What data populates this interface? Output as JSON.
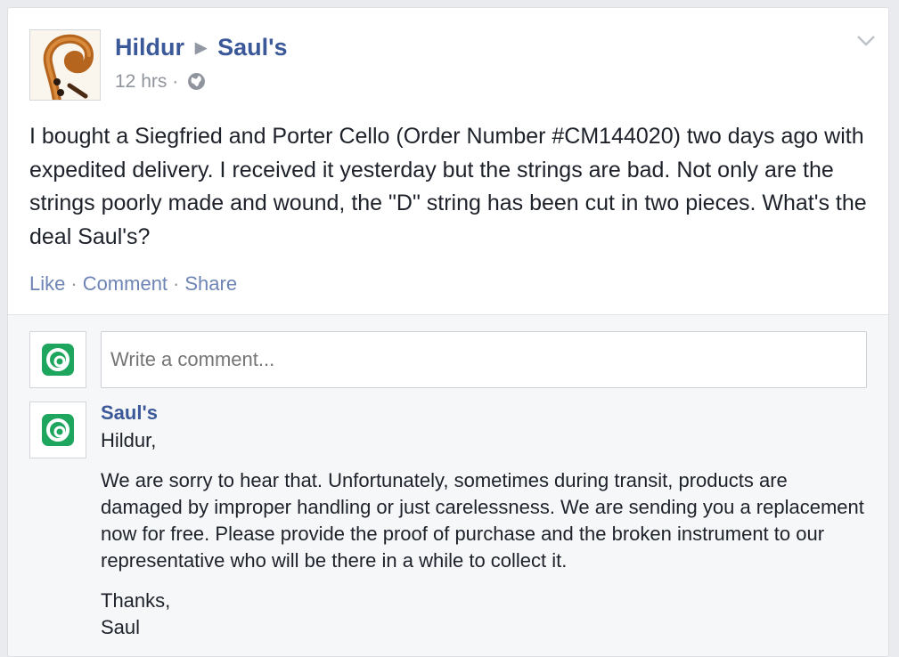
{
  "post": {
    "author": "Hildur",
    "target_page": "Saul's",
    "timestamp": "12 hrs",
    "separator": "·",
    "privacy_icon": "globe-icon",
    "menu_icon": "chevron-down-icon",
    "body": "I bought a Siegfried and Porter Cello (Order Number #CM144020) two days ago with expedited delivery. I received it yesterday but the strings are bad. Not only are the strings poorly made and wound, the \"D\" string has been cut in two pieces. What's the deal Saul's?",
    "actions": {
      "like": "Like",
      "comment": "Comment",
      "share": "Share",
      "separator": "·"
    }
  },
  "comment_box": {
    "placeholder": "Write a comment..."
  },
  "reply": {
    "author": "Saul's",
    "greeting": "Hildur,",
    "message": "We are sorry to hear that. Unfortunately, sometimes during transit, products are damaged by improper handling or just carelessness. We are sending you a replacement now for free. Please provide the proof of purchase and the broken instrument to our representative who will be there in a while to collect it.",
    "signoff": "Thanks,",
    "signature": "Saul"
  },
  "colors": {
    "link": "#3b5998",
    "action_link": "#6d84b4",
    "muted": "#90949c",
    "text": "#1d2129",
    "brand_green": "#1fa65e"
  }
}
